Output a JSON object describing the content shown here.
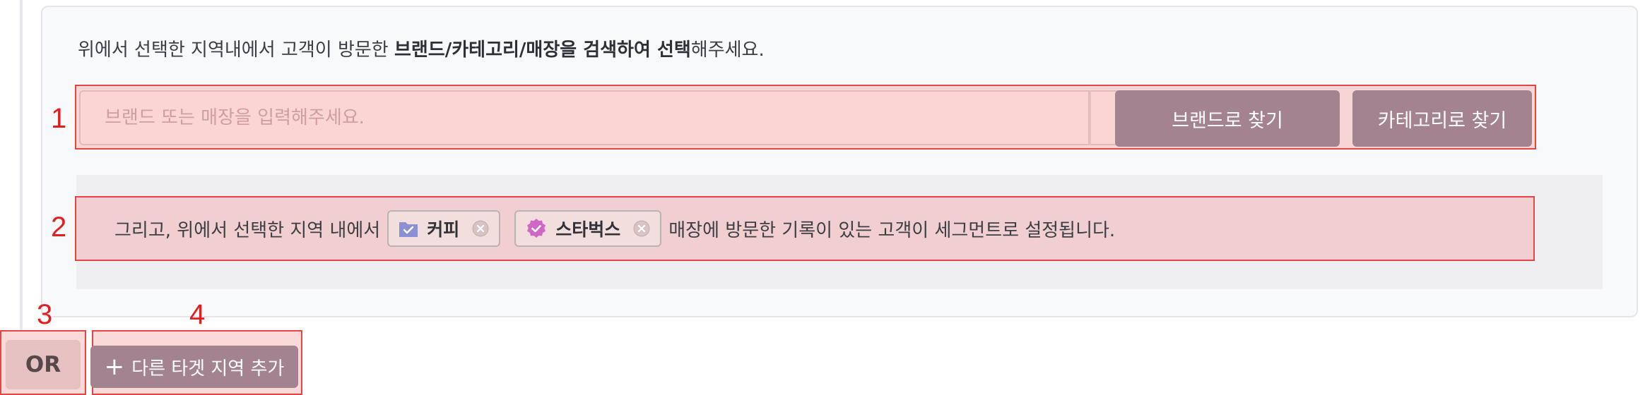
{
  "instruction": {
    "prefix": "위에서 선택한 지역내에서 고객이 방문한 ",
    "emphasis": "브랜드/카테고리/매장을 검색하여 선택",
    "suffix": "해주세요."
  },
  "search": {
    "placeholder": "브랜드 또는 매장을 입력해주세요.",
    "icon": "search-icon"
  },
  "buttons": {
    "find_by_brand": "브랜드로 찾기",
    "find_by_category": "카테고리로 찾기",
    "or": "OR",
    "add_region": "다른 타겟 지역 추가"
  },
  "summary": {
    "prefix": "그리고, 위에서 선택한 지역 내에서",
    "suffix": "매장에 방문한 기록이 있는 고객이 세그먼트로 설정됩니다.",
    "chips": [
      {
        "label": "커피",
        "icon": "folder-check-icon",
        "color": "#8b8fd6"
      },
      {
        "label": "스타벅스",
        "icon": "verified-badge-icon",
        "color": "#d067c7"
      }
    ]
  },
  "markers": [
    "1",
    "2",
    "3",
    "4"
  ],
  "colors": {
    "highlight_border": "#e64545",
    "marker": "#e02020",
    "primary_button": "#a3838f"
  }
}
